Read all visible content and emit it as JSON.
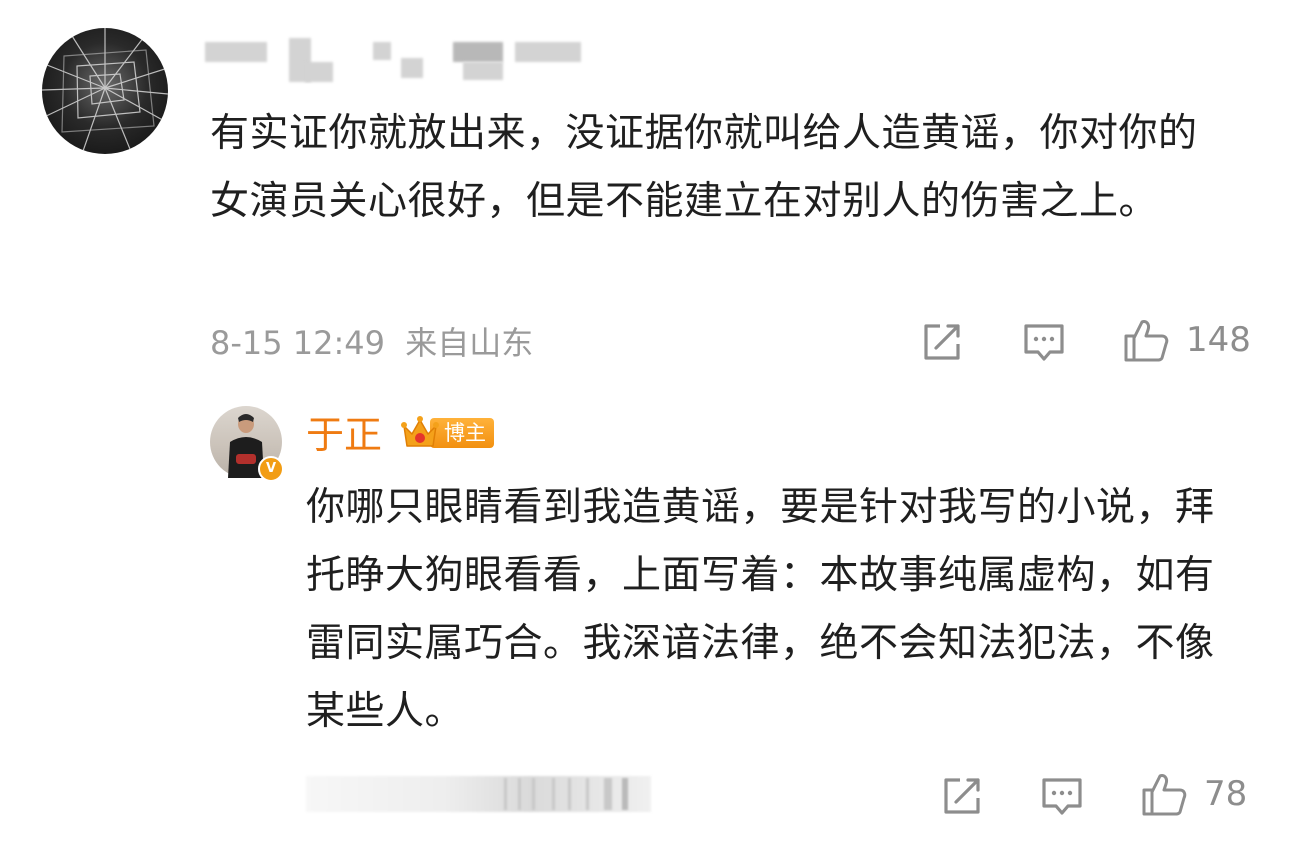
{
  "comment": {
    "avatar_icon": "shattered-glass-avatar-icon",
    "text": "有实证你就放出来，没证据你就叫给人造黄谣，你对你的女演员关心很好，但是不能建立在对别人的伤害之上。",
    "timestamp": "8-15 12:49",
    "location": "来自山东",
    "actions": {
      "share_icon": "share-icon",
      "reply_icon": "comment-icon",
      "like_icon": "thumbs-up-icon",
      "like_count": "148"
    }
  },
  "reply": {
    "author_name": "于正",
    "author_badge": "博主",
    "verified_badge": "V",
    "text": "你哪只眼睛看到我造黄谣，要是针对我写的小说，拜托睁大狗眼看看，上面写着：本故事纯属虚构，如有雷同实属巧合。我深谙法律，绝不会知法犯法，不像某些人。",
    "actions": {
      "share_icon": "share-icon",
      "reply_icon": "comment-icon",
      "like_icon": "thumbs-up-icon",
      "like_count": "78"
    }
  },
  "colors": {
    "author_name": "#ef7b12",
    "badge": "#f29010",
    "meta_gray": "#9a9a9a"
  }
}
